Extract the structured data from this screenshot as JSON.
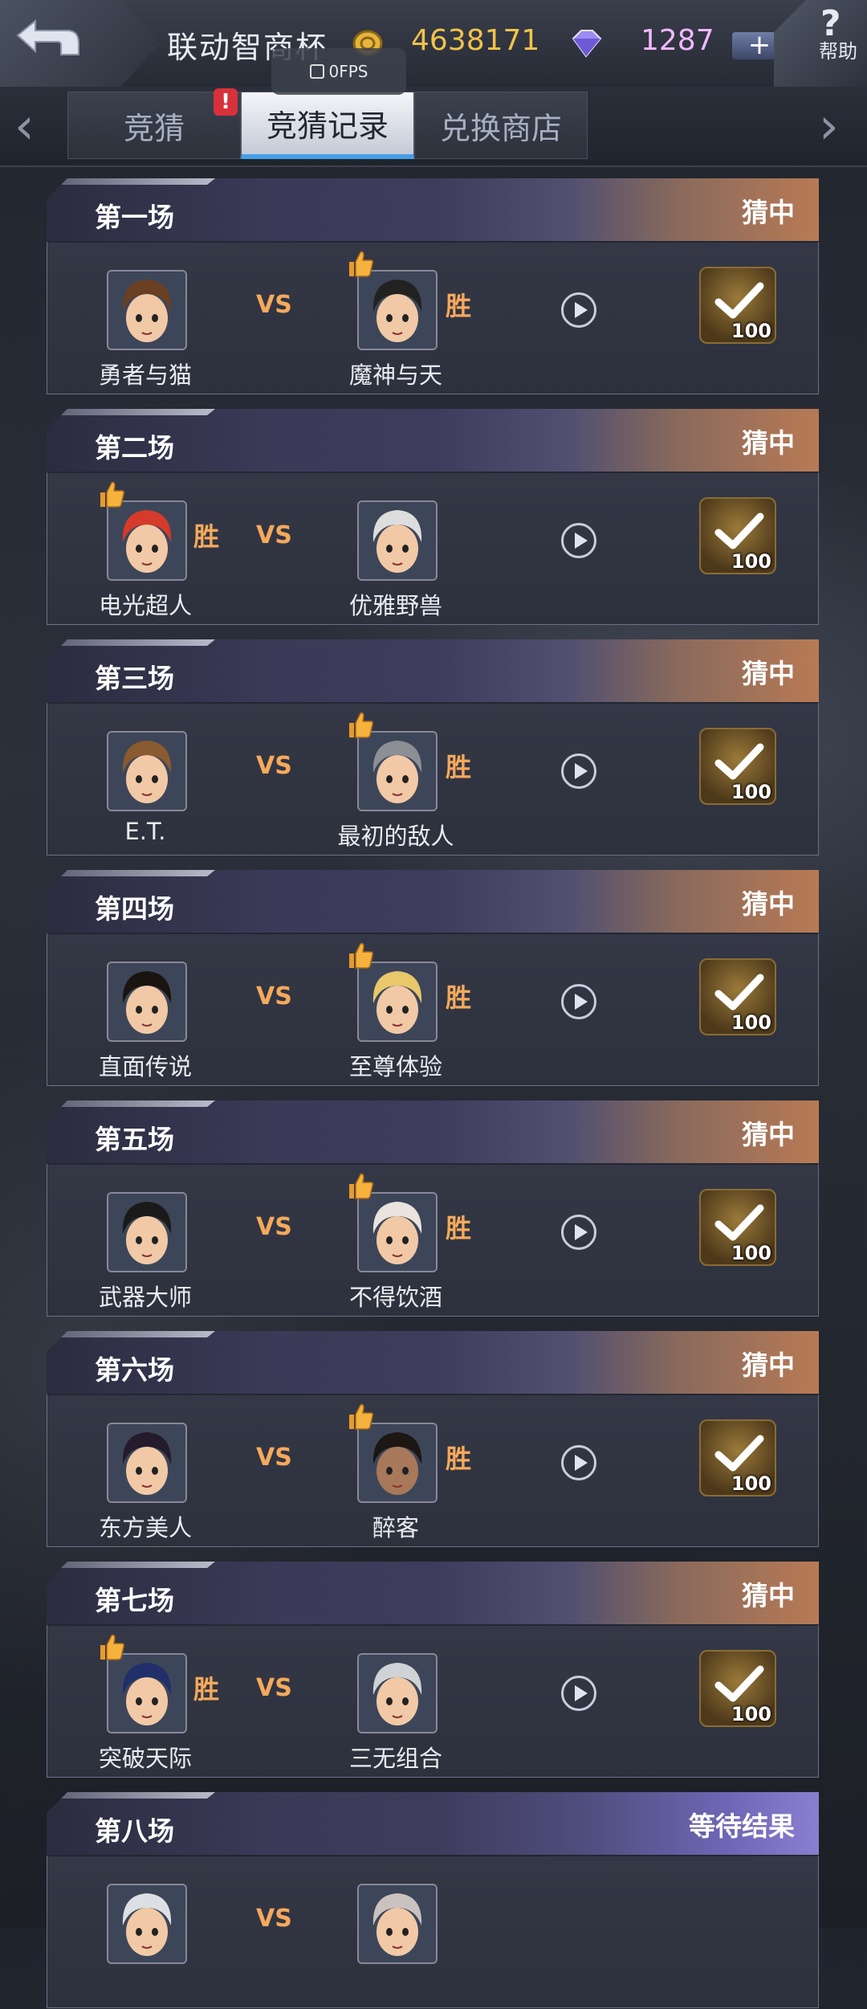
{
  "header": {
    "title": "联动智商杯",
    "coins": "4638171",
    "gems": "1287",
    "plus": "+",
    "help_glyph": "?",
    "help_label": "帮助",
    "fps": "0FPS",
    "alert": "!"
  },
  "tabs": [
    {
      "label": "竞猜",
      "active": false
    },
    {
      "label": "竞猜记录",
      "active": true
    },
    {
      "label": "兑换商店",
      "active": false
    }
  ],
  "labels": {
    "vs": "VS",
    "win": "胜",
    "arrow_left": "‹",
    "arrow_right": "›"
  },
  "matches": [
    {
      "name": "第一场",
      "result": "猜中",
      "left": "勇者与猫",
      "right": "魔神与天",
      "winner": "right",
      "reward": "100"
    },
    {
      "name": "第二场",
      "result": "猜中",
      "left": "电光超人",
      "right": "优雅野兽",
      "winner": "left",
      "reward": "100"
    },
    {
      "name": "第三场",
      "result": "猜中",
      "left": "E.T.",
      "right": "最初的敌人",
      "winner": "right",
      "reward": "100"
    },
    {
      "name": "第四场",
      "result": "猜中",
      "left": "直面传说",
      "right": "至尊体验",
      "winner": "right",
      "reward": "100"
    },
    {
      "name": "第五场",
      "result": "猜中",
      "left": "武器大师",
      "right": "不得饮酒",
      "winner": "right",
      "reward": "100"
    },
    {
      "name": "第六场",
      "result": "猜中",
      "left": "东方美人",
      "right": "醉客",
      "winner": "right",
      "reward": "100"
    },
    {
      "name": "第七场",
      "result": "猜中",
      "left": "突破天际",
      "right": "三无组合",
      "winner": "left",
      "reward": "100"
    },
    {
      "name": "第八场",
      "result": "等待结果",
      "left": "",
      "right": "",
      "winner": "none",
      "reward": "",
      "pending": true
    }
  ],
  "colors": {
    "accent_orange": "#f5a95c",
    "coin": "#f2c24a",
    "gem": "#f2b8ff",
    "tab_underline": "#45a0e8"
  }
}
